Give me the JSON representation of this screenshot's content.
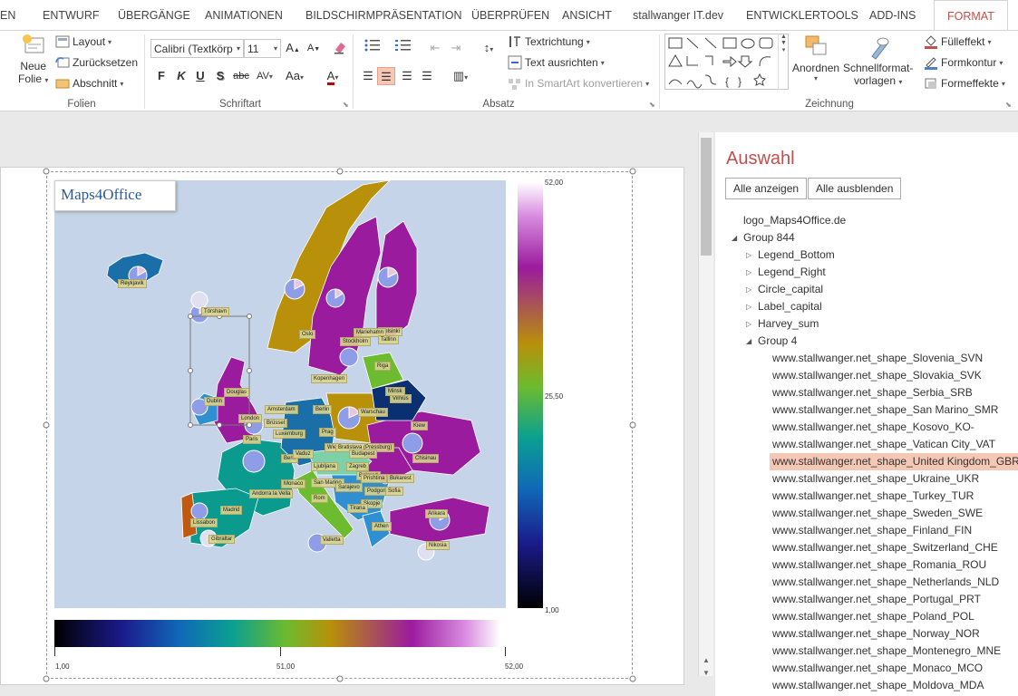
{
  "tabs": [
    {
      "label": "EN",
      "active": false
    },
    {
      "label": "ENTWURF",
      "active": false
    },
    {
      "label": "ÜBERGÄNGE",
      "active": false
    },
    {
      "label": "ANIMATIONEN",
      "active": false
    },
    {
      "label": "BILDSCHIRMPRÄSENTATION",
      "active": false
    },
    {
      "label": "ÜBERPRÜFEN",
      "active": false
    },
    {
      "label": "ANSICHT",
      "active": false
    },
    {
      "label": "stallwanger IT.dev",
      "active": false
    },
    {
      "label": "ENTWICKLERTOOLS",
      "active": false
    },
    {
      "label": "ADD-INS",
      "active": false
    },
    {
      "label": "FORMAT",
      "active": true
    }
  ],
  "ribbon": {
    "folien": {
      "group_label": "Folien",
      "neue_folie_1": "Neue",
      "neue_folie_2": "Folie",
      "layout": "Layout",
      "zuruecksetzen": "Zurücksetzen",
      "abschnitt": "Abschnitt"
    },
    "schriftart": {
      "group_label": "Schriftart",
      "font_value": "Calibri (Textkörp",
      "size_value": "11",
      "bold": "F",
      "italic": "K",
      "underline": "U",
      "shadow": "S",
      "strike": "abc",
      "spacing": "AV",
      "case": "Aa",
      "color": "A"
    },
    "absatz": {
      "group_label": "Absatz",
      "textrichtung": "Textrichtung",
      "text_ausrichten": "Text ausrichten",
      "smartart": "In SmartArt konvertieren"
    },
    "zeichnung": {
      "group_label": "Zeichnung",
      "anordnen": "Anordnen",
      "schnellformat_1": "Schnellformat-",
      "schnellformat_2": "vorlagen",
      "fuelleffekt": "Fülleffekt",
      "formkontur": "Formkontur",
      "formeffekte": "Formeffekte"
    }
  },
  "slide": {
    "logo_text": "Maps4Office",
    "legend_right_ticks": [
      "52,00",
      "25,50",
      "1,00"
    ],
    "legend_bottom_ticks": [
      "1,00",
      "51,00",
      "52,00"
    ],
    "capitals": [
      "Reykjavik",
      "Oslo",
      "Stockholm",
      "Helsinki",
      "Mariehamn",
      "Tallinn",
      "Riga",
      "Kopenhagen",
      "Vilnius",
      "Minsk",
      "Douglas",
      "Dublin",
      "London",
      "Amsterdam",
      "Brüssel",
      "Berlin",
      "Warschau",
      "Kiew",
      "Luxemburg",
      "Prag",
      "Paris",
      "Bern",
      "Vaduz",
      "Wien",
      "Bratislava (Pressburg)",
      "Budapest",
      "Chisinau",
      "Ljubljana",
      "Zagreb",
      "Belgrad",
      "Bukarest",
      "Monaco",
      "San Marino",
      "Sarajevo",
      "Andorra la Vella",
      "Rom",
      "Podgorica",
      "Prishtina",
      "Sofia",
      "Skopje",
      "Madrid",
      "Lissabon",
      "Tirana",
      "Athen",
      "Ankara",
      "Gibraltar",
      "Valletta",
      "Nikosia",
      "Tórshavn"
    ]
  },
  "selection_pane": {
    "title": "Auswahl",
    "show_all": "Alle anzeigen",
    "hide_all": "Alle ausblenden",
    "items": [
      {
        "label": "logo_Maps4Office.de",
        "level": 0,
        "twisty": "",
        "selected": false
      },
      {
        "label": "Group 844",
        "level": 0,
        "twisty": "open",
        "selected": false
      },
      {
        "label": "Legend_Bottom",
        "level": 1,
        "twisty": "closed",
        "selected": false
      },
      {
        "label": "Legend_Right",
        "level": 1,
        "twisty": "closed",
        "selected": false
      },
      {
        "label": "Circle_capital",
        "level": 1,
        "twisty": "closed",
        "selected": false
      },
      {
        "label": "Label_capital",
        "level": 1,
        "twisty": "closed",
        "selected": false
      },
      {
        "label": "Harvey_sum",
        "level": 1,
        "twisty": "closed",
        "selected": false
      },
      {
        "label": "Group 4",
        "level": 1,
        "twisty": "open",
        "selected": false
      },
      {
        "label": "www.stallwanger.net_shape_Slovenia_SVN",
        "level": 2,
        "twisty": "",
        "selected": false
      },
      {
        "label": "www.stallwanger.net_shape_Slovakia_SVK",
        "level": 2,
        "twisty": "",
        "selected": false
      },
      {
        "label": "www.stallwanger.net_shape_Serbia_SRB",
        "level": 2,
        "twisty": "",
        "selected": false
      },
      {
        "label": "www.stallwanger.net_shape_San Marino_SMR",
        "level": 2,
        "twisty": "",
        "selected": false
      },
      {
        "label": "www.stallwanger.net_shape_Kosovo_KO-",
        "level": 2,
        "twisty": "",
        "selected": false
      },
      {
        "label": "www.stallwanger.net_shape_Vatican City_VAT",
        "level": 2,
        "twisty": "",
        "selected": false
      },
      {
        "label": "www.stallwanger.net_shape_United Kingdom_GBR",
        "level": 2,
        "twisty": "",
        "selected": true
      },
      {
        "label": "www.stallwanger.net_shape_Ukraine_UKR",
        "level": 2,
        "twisty": "",
        "selected": false
      },
      {
        "label": "www.stallwanger.net_shape_Turkey_TUR",
        "level": 2,
        "twisty": "",
        "selected": false
      },
      {
        "label": "www.stallwanger.net_shape_Sweden_SWE",
        "level": 2,
        "twisty": "",
        "selected": false
      },
      {
        "label": "www.stallwanger.net_shape_Finland_FIN",
        "level": 2,
        "twisty": "",
        "selected": false
      },
      {
        "label": "www.stallwanger.net_shape_Switzerland_CHE",
        "level": 2,
        "twisty": "",
        "selected": false
      },
      {
        "label": "www.stallwanger.net_shape_Romania_ROU",
        "level": 2,
        "twisty": "",
        "selected": false
      },
      {
        "label": "www.stallwanger.net_shape_Netherlands_NLD",
        "level": 2,
        "twisty": "",
        "selected": false
      },
      {
        "label": "www.stallwanger.net_shape_Portugal_PRT",
        "level": 2,
        "twisty": "",
        "selected": false
      },
      {
        "label": "www.stallwanger.net_shape_Poland_POL",
        "level": 2,
        "twisty": "",
        "selected": false
      },
      {
        "label": "www.stallwanger.net_shape_Norway_NOR",
        "level": 2,
        "twisty": "",
        "selected": false
      },
      {
        "label": "www.stallwanger.net_shape_Montenegro_MNE",
        "level": 2,
        "twisty": "",
        "selected": false
      },
      {
        "label": "www.stallwanger.net_shape_Monaco_MCO",
        "level": 2,
        "twisty": "",
        "selected": false
      },
      {
        "label": "www.stallwanger.net_shape_Moldova_MDA",
        "level": 2,
        "twisty": "",
        "selected": false
      }
    ]
  },
  "colors": {
    "accent": "#c0504d",
    "selection": "#f5c8b6",
    "map_sea": "#c5d4e8"
  }
}
